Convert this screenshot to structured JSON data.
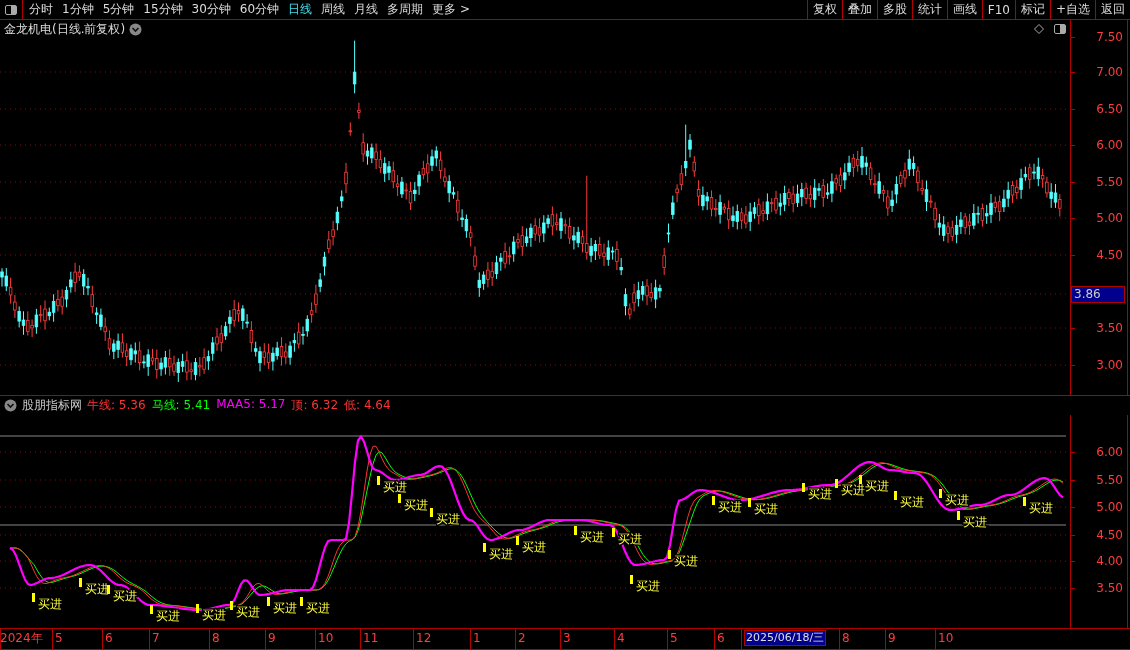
{
  "toolbar": {
    "periods": [
      {
        "label": "分时",
        "selected": false
      },
      {
        "label": "1分钟",
        "selected": false
      },
      {
        "label": "5分钟",
        "selected": false
      },
      {
        "label": "15分钟",
        "selected": false
      },
      {
        "label": "30分钟",
        "selected": false
      },
      {
        "label": "60分钟",
        "selected": false
      },
      {
        "label": "日线",
        "selected": true
      },
      {
        "label": "周线",
        "selected": false
      },
      {
        "label": "月线",
        "selected": false
      },
      {
        "label": "多周期",
        "selected": false
      },
      {
        "label": "更多 >",
        "selected": false
      }
    ],
    "actions": [
      "复权",
      "叠加",
      "多股",
      "统计",
      "画线",
      "F10",
      "标记",
      "+自选",
      "返回"
    ]
  },
  "price_chart": {
    "title": "金龙机电(日线.前复权)",
    "price_axis": [
      "7.50",
      "7.00",
      "6.50",
      "6.00",
      "5.50",
      "5.00",
      "4.50",
      "3.50",
      "3.00"
    ],
    "current_price": "3.86"
  },
  "indicator": {
    "name": "股朋指标网",
    "legend": [
      {
        "label": "牛线: 5.36",
        "color": "#ff3232"
      },
      {
        "label": "马线: 5.41",
        "color": "#00ff00"
      },
      {
        "label": "MAA5: 5.17",
        "color": "#ff00ff"
      },
      {
        "label": "顶: 6.32",
        "color": "#ff3232"
      },
      {
        "label": "低: 4.64",
        "color": "#ff3232"
      }
    ],
    "axis": [
      "6.00",
      "5.50",
      "5.00",
      "4.50",
      "4.00",
      "3.50"
    ],
    "signals": [
      "买进",
      "买进",
      "买进",
      "买进",
      "买进",
      "买进",
      "买进",
      "买进",
      "买进",
      "买进",
      "买进",
      "买进",
      "买进",
      "买进",
      "买进",
      "买进",
      "买进",
      "买进",
      "买进",
      "买进",
      "买进",
      "买进",
      "买进",
      "买进",
      "买进",
      "买进"
    ]
  },
  "time_axis": [
    {
      "label": "2024年",
      "selected": false
    },
    {
      "label": "5",
      "selected": false
    },
    {
      "label": "6",
      "selected": false
    },
    {
      "label": "7",
      "selected": false
    },
    {
      "label": "8",
      "selected": false
    },
    {
      "label": "9",
      "selected": false
    },
    {
      "label": "10",
      "selected": false
    },
    {
      "label": "11",
      "selected": false
    },
    {
      "label": "12",
      "selected": false
    },
    {
      "label": "1",
      "selected": false
    },
    {
      "label": "2",
      "selected": false
    },
    {
      "label": "3",
      "selected": false
    },
    {
      "label": "4",
      "selected": false
    },
    {
      "label": "5",
      "selected": false
    },
    {
      "label": "6",
      "selected": false
    },
    {
      "label": "2025/06/18/三",
      "selected": true
    },
    {
      "label": "8",
      "selected": false
    },
    {
      "label": "9",
      "selected": false
    },
    {
      "label": "10",
      "selected": false
    }
  ]
}
